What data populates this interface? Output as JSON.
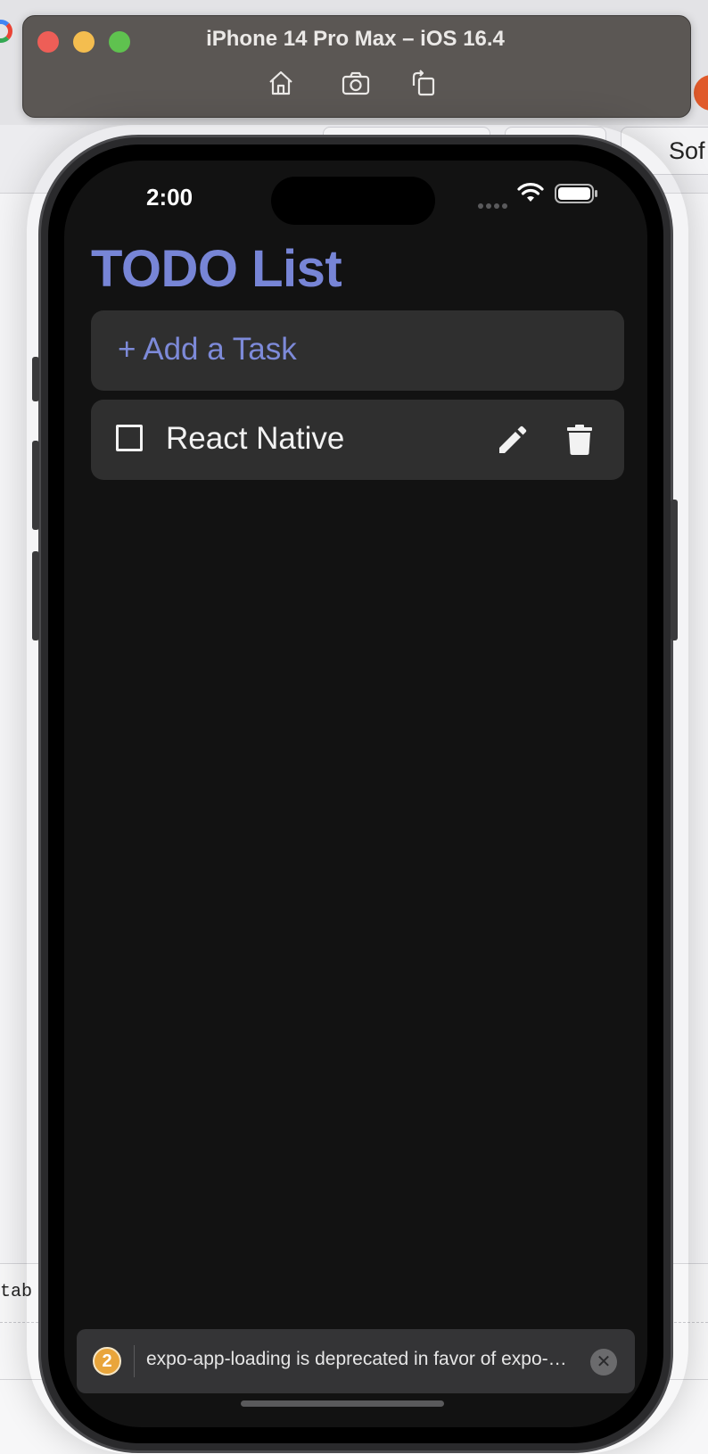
{
  "simulator": {
    "window_title": "iPhone 14 Pro Max – iOS 16.4",
    "toolbar": {
      "home_icon": "home-icon",
      "screenshot_icon": "camera-icon",
      "rotate_icon": "rotate-icon"
    }
  },
  "background": {
    "tab_label": "Sof",
    "console_text": "tab"
  },
  "status_bar": {
    "time": "2:00"
  },
  "app": {
    "title": "TODO List",
    "add_task_label": "+ Add a Task",
    "tasks": [
      {
        "label": "React Native",
        "completed": false
      }
    ]
  },
  "toast": {
    "count": "2",
    "message": "expo-app-loading is deprecated in favor of expo-splash-screen: use SplashScreen.preventAutoHideAsync() and SplashScreen.hideAsync() instead.",
    "close_symbol": "✕"
  },
  "colors": {
    "accent": "#7785d6",
    "screen_background": "#121212",
    "card_background": "#2f2f2f",
    "warning_badge": "#e9a53b"
  }
}
